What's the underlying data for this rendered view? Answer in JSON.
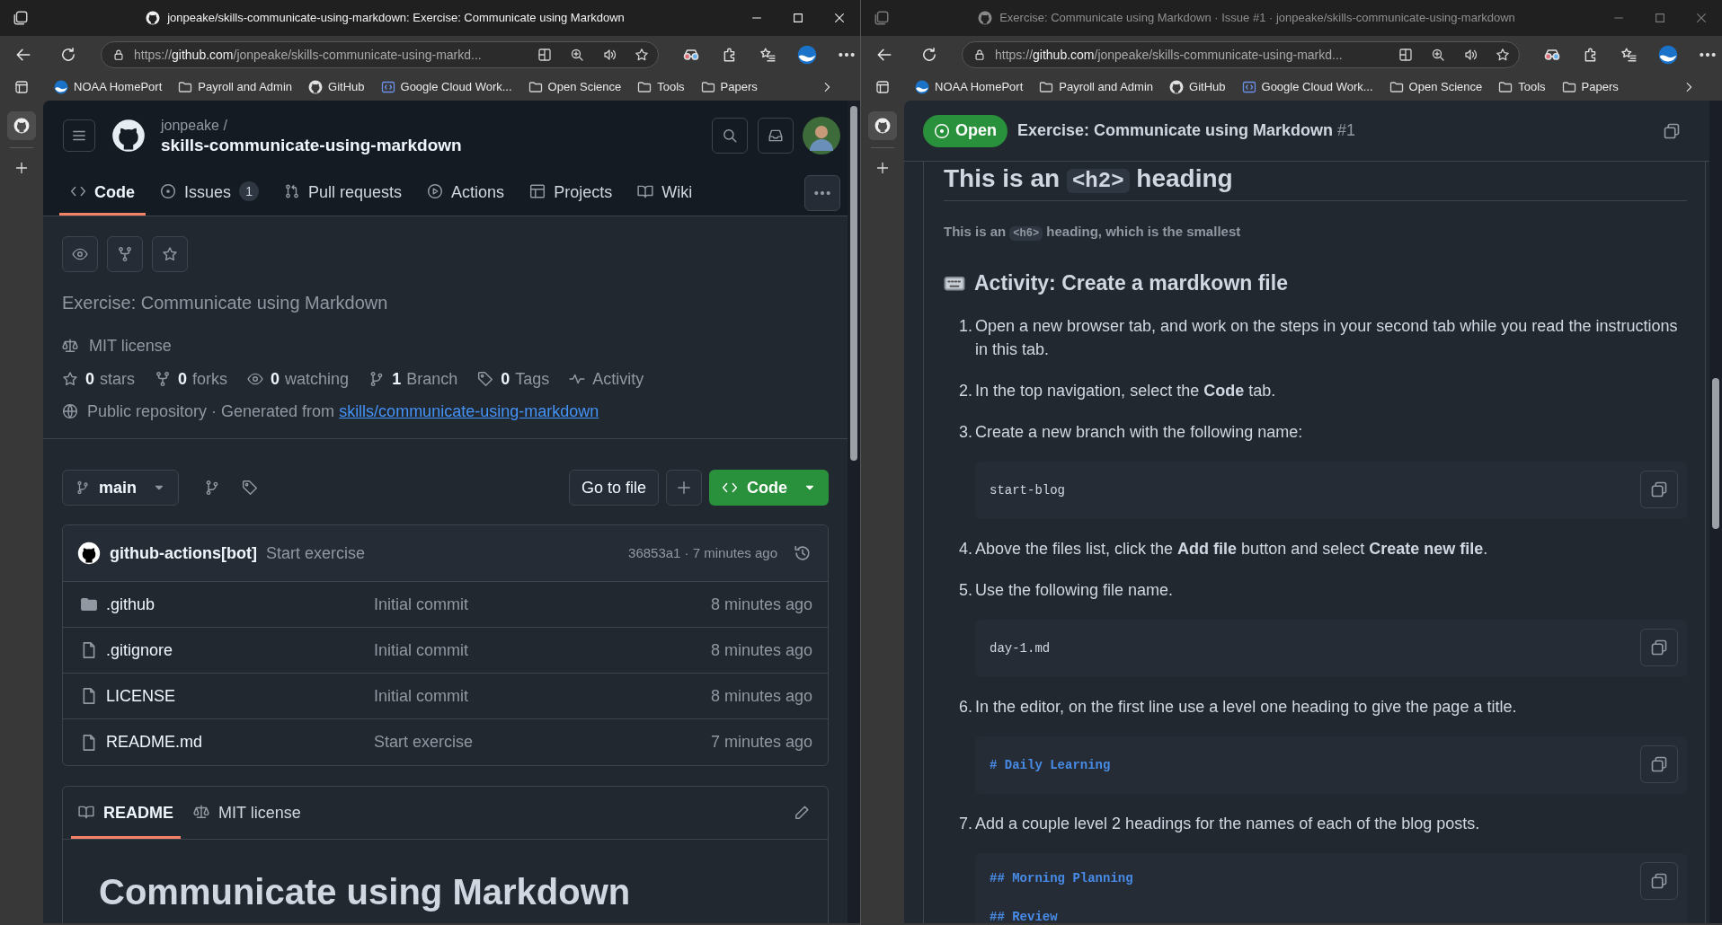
{
  "windows": [
    {
      "title": "jonpeake/skills-communicate-using-markdown: Exercise: Communicate using Markdown",
      "active": true,
      "url": {
        "scheme": "https://",
        "host": "github.com",
        "path": "/jonpeake/skills-communicate-using-markd..."
      },
      "bookmarks": [
        {
          "label": "NOAA HomePort",
          "kind": "noaa"
        },
        {
          "label": "Payroll and Admin",
          "kind": "folder"
        },
        {
          "label": "GitHub",
          "kind": "github"
        },
        {
          "label": "Google Cloud Work...",
          "kind": "cloud"
        },
        {
          "label": "Open Science",
          "kind": "folder"
        },
        {
          "label": "Tools",
          "kind": "folder"
        },
        {
          "label": "Papers",
          "kind": "folder"
        }
      ]
    },
    {
      "title": "Exercise: Communicate using Markdown · Issue #1 · jonpeake/skills-communicate-using-markdown",
      "active": false,
      "url": {
        "scheme": "https://",
        "host": "github.com",
        "path": "/jonpeake/skills-communicate-using-markd..."
      },
      "bookmarks": [
        {
          "label": "NOAA HomePort",
          "kind": "noaa"
        },
        {
          "label": "Payroll and Admin",
          "kind": "folder"
        },
        {
          "label": "GitHub",
          "kind": "github"
        },
        {
          "label": "Google Cloud Work...",
          "kind": "cloud"
        },
        {
          "label": "Open Science",
          "kind": "folder"
        },
        {
          "label": "Tools",
          "kind": "folder"
        },
        {
          "label": "Papers",
          "kind": "folder"
        }
      ]
    }
  ],
  "repo_page": {
    "owner": "jonpeake /",
    "name": "skills-communicate-using-markdown",
    "tabs": [
      {
        "label": "Code",
        "kind": "code",
        "selected": true
      },
      {
        "label": "Issues",
        "kind": "issue",
        "counter": "1",
        "selected": false
      },
      {
        "label": "Pull requests",
        "kind": "pr",
        "selected": false
      },
      {
        "label": "Actions",
        "kind": "play",
        "selected": false
      },
      {
        "label": "Projects",
        "kind": "table",
        "selected": false
      },
      {
        "label": "Wiki",
        "kind": "book",
        "selected": false
      }
    ],
    "description": "Exercise: Communicate using Markdown",
    "license": "MIT license",
    "stats": [
      {
        "kind": "star",
        "count": "0",
        "label": "stars"
      },
      {
        "kind": "fork",
        "count": "0",
        "label": "forks"
      },
      {
        "kind": "eye",
        "count": "0",
        "label": "watching"
      },
      {
        "kind": "branch",
        "count": "1",
        "label": "Branch"
      },
      {
        "kind": "tag",
        "count": "0",
        "label": "Tags"
      },
      {
        "kind": "pulse",
        "label": "Activity"
      }
    ],
    "visibility": "Public repository · Generated from ",
    "template_link": "skills/communicate-using-markdown",
    "branch": "main",
    "go_to_file": "Go to file",
    "code_button": "Code",
    "commit": {
      "author": "github-actions[bot]",
      "message": "Start exercise",
      "meta": "36853a1 · 7 minutes ago"
    },
    "files": [
      {
        "name": ".github",
        "kind": "folder",
        "message": "Initial commit",
        "time": "8 minutes ago"
      },
      {
        "name": ".gitignore",
        "kind": "file",
        "message": "Initial commit",
        "time": "8 minutes ago"
      },
      {
        "name": "LICENSE",
        "kind": "file",
        "message": "Initial commit",
        "time": "8 minutes ago"
      },
      {
        "name": "README.md",
        "kind": "file",
        "message": "Start exercise",
        "time": "7 minutes ago"
      }
    ],
    "readme_tabs": [
      {
        "label": "README",
        "kind": "book",
        "selected": true
      },
      {
        "label": "MIT license",
        "kind": "law",
        "selected": false
      }
    ],
    "readme_heading": "Communicate using Markdown"
  },
  "issue_page": {
    "state": "Open",
    "title": "Exercise: Communicate using Markdown",
    "number": "#1",
    "h2": [
      {
        "text": "This is an ",
        "kind": "text"
      },
      {
        "text": "<h2>",
        "kind": "code"
      },
      {
        "text": " heading",
        "kind": "text"
      }
    ],
    "h6": [
      {
        "text": "This is an ",
        "kind": "text"
      },
      {
        "text": "<h6>",
        "kind": "code"
      },
      {
        "text": " heading, which is the smallest",
        "kind": "text"
      }
    ],
    "activity_heading": "Activity: Create a mardkown file",
    "steps": [
      {
        "number": "1.",
        "text": "Open a new browser tab, and work on the steps in your second tab while you read the instructions in this tab."
      },
      {
        "number": "2.",
        "text": "In the top navigation, select the **Code** tab."
      },
      {
        "number": "3.",
        "text": "Create a new branch with the following name:",
        "code": {
          "kind": "plain",
          "lines": [
            "start-blog"
          ]
        }
      },
      {
        "number": "4.",
        "text": "Above the files list, click the **Add file** button and select **Create new file**."
      },
      {
        "number": "5.",
        "text": "Use the following file name.",
        "code": {
          "kind": "plain",
          "lines": [
            "day-1.md"
          ]
        }
      },
      {
        "number": "6.",
        "text": "In the editor, on the first line use a level one heading to give the page a title.",
        "code": {
          "kind": "heading",
          "lines": [
            "# Daily Learning"
          ]
        }
      },
      {
        "number": "7.",
        "text": "Add a couple level 2 headings for the names of each of the blog posts.",
        "code": {
          "kind": "heading",
          "lines": [
            "## Morning Planning",
            "## Review"
          ]
        }
      }
    ]
  }
}
